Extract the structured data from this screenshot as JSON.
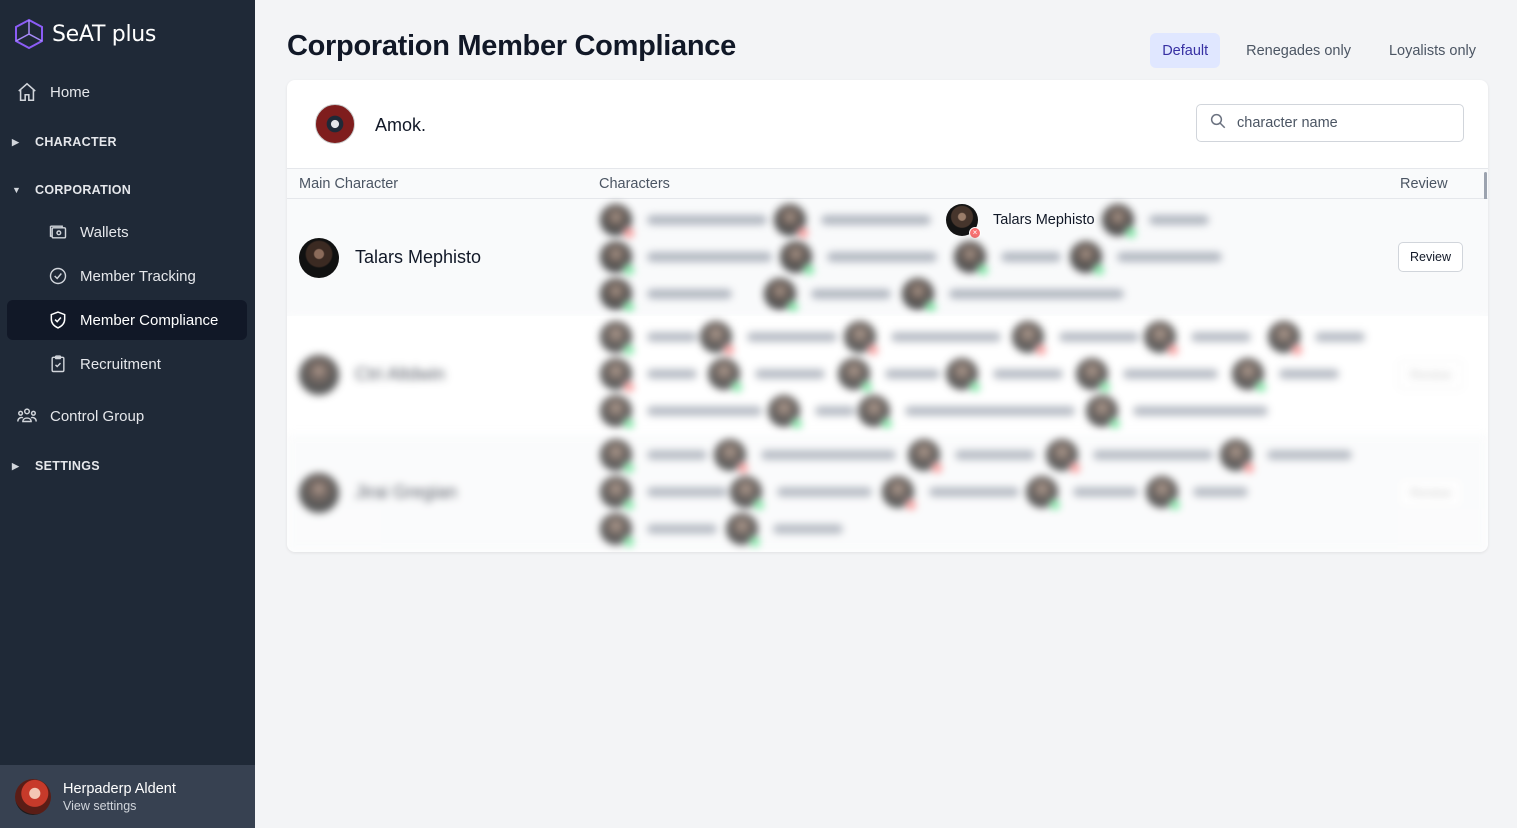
{
  "app": {
    "name": "SeAT plus"
  },
  "sidebar": {
    "home": "Home",
    "character": "CHARACTER",
    "corporation": "CORPORATION",
    "items": [
      {
        "label": "Wallets",
        "icon": "wallet-icon"
      },
      {
        "label": "Member Tracking",
        "icon": "check-circle-icon"
      },
      {
        "label": "Member Compliance",
        "icon": "shield-check-icon",
        "active": true
      },
      {
        "label": "Recruitment",
        "icon": "clipboard-check-icon"
      }
    ],
    "control_group": "Control Group",
    "settings": "SETTINGS"
  },
  "user": {
    "name": "Herpaderp Aldent",
    "sub": "View settings"
  },
  "page": {
    "title": "Corporation Member Compliance",
    "filters": [
      "Default",
      "Renegades only",
      "Loyalists only"
    ],
    "active_filter": "Default"
  },
  "corporation": {
    "name": "Amok."
  },
  "search": {
    "placeholder": "character name",
    "value": ""
  },
  "table": {
    "headers": [
      "Main Character",
      "Characters",
      "Review"
    ],
    "rows": [
      {
        "main": "Talars Mephisto",
        "highlighted_character": "Talars Mephisto",
        "review_label": "Review"
      },
      {
        "main": "Ctri Altdwin",
        "review_label": "Review"
      },
      {
        "main": "Jirai Gregian",
        "review_label": "Review"
      }
    ]
  },
  "colors": {
    "sidebar_bg": "#1f2937",
    "active_filter_bg": "#e0e7ff",
    "active_filter_text": "#3730a3",
    "renegade_badge": "#f87171",
    "loyal_badge": "#4ade80"
  }
}
